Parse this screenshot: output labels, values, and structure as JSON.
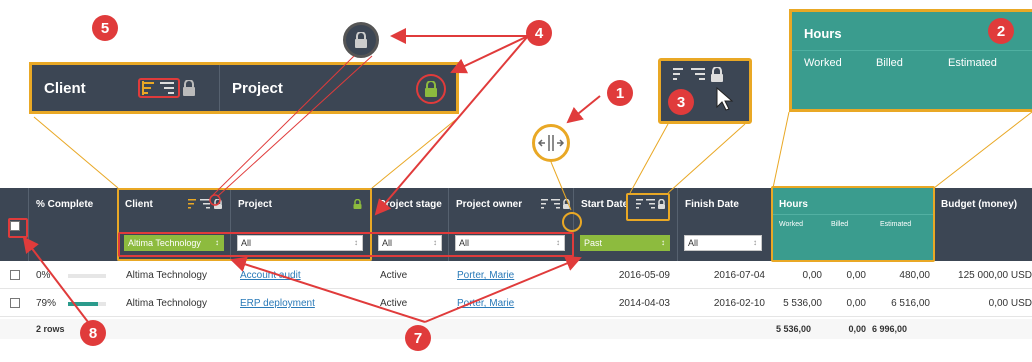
{
  "callouts": {
    "zoom_client": "Client",
    "zoom_project": "Project",
    "zoom_hours": {
      "title": "Hours",
      "sub": [
        "Worked",
        "Billed",
        "Estimated"
      ]
    },
    "badges": [
      "1",
      "2",
      "3",
      "4",
      "5",
      "7",
      "8"
    ]
  },
  "grid": {
    "columns": {
      "complete": "% Complete",
      "client": "Client",
      "project": "Project",
      "stage": "Project stage",
      "owner": "Project owner",
      "start": "Start Date",
      "finish": "Finish Date",
      "hours": "Hours",
      "hours_sub": [
        "Worked",
        "Billed",
        "Estimated"
      ],
      "budget": "Budget (money)"
    },
    "filters": {
      "client": "Altima Technology",
      "project": "All",
      "stage": "All",
      "owner": "All",
      "start": "Past",
      "finish": "All"
    },
    "rows": [
      {
        "complete": "0%",
        "complete_frac": 0.0,
        "client": "Altima Technology",
        "project": "Account audit",
        "stage": "Active",
        "owner": "Porter, Marie",
        "start": "2016-05-09",
        "finish": "2016-07-04",
        "worked": "0,00",
        "billed": "0,00",
        "estimated": "480,00",
        "budget": "125 000,00 USD"
      },
      {
        "complete": "79%",
        "complete_frac": 0.79,
        "client": "Altima Technology",
        "project": "ERP deployment",
        "stage": "Active",
        "owner": "Porter, Marie",
        "start": "2014-04-03",
        "finish": "2016-02-10",
        "worked": "5 536,00",
        "billed": "0,00",
        "estimated": "6 516,00",
        "budget": "0,00 USD"
      }
    ],
    "footer": {
      "rows_label": "2 rows",
      "worked": "5 536,00",
      "billed": "0,00",
      "estimated": "6 996,00"
    }
  },
  "icons": [
    "sort-asc-icon",
    "sort-desc-icon",
    "lock-icon",
    "resize-handle-icon",
    "cursor-icon",
    "chevron-down-icon"
  ],
  "colors": {
    "header": "#3c4654",
    "hours_band": "#3a9c8e",
    "callout_frame": "#e9a825",
    "badge": "#e03b3b",
    "filter_active": "#8dbb3e",
    "link": "#2a7ab8"
  }
}
